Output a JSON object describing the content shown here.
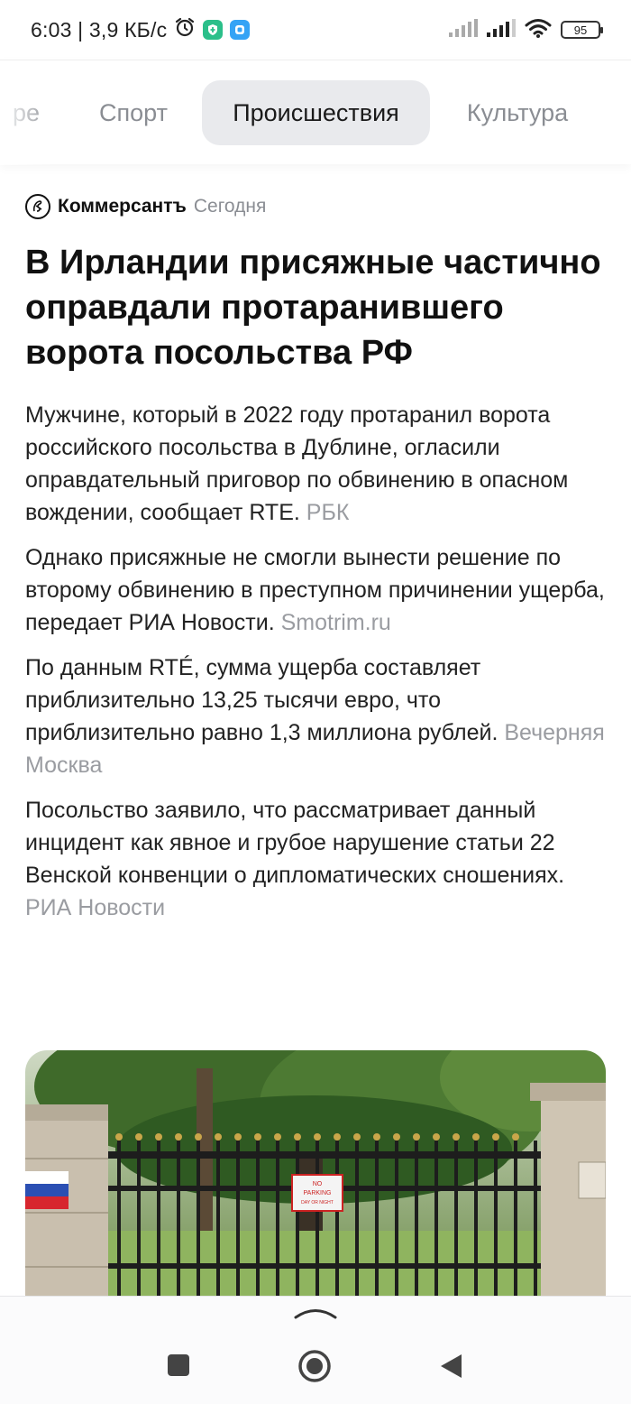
{
  "status_bar": {
    "time_speed": "6:03 | 3,9 КБ/с",
    "battery": "95"
  },
  "tabs": [
    {
      "label": "ре"
    },
    {
      "label": "Спорт"
    },
    {
      "label": "Происшествия"
    },
    {
      "label": "Культура"
    }
  ],
  "article": {
    "source": "Коммерсантъ",
    "time": "Сегодня",
    "headline": "В Ирландии присяжные частично оправдали протаранившего ворота посольства РФ",
    "paragraphs": [
      {
        "text": "Мужчине, который в 2022 году протаранил ворота российского посольства в Дублине, огласили оправдательный приговор по обвинению в опасном вождении, сообщает RTE.",
        "source": "РБК"
      },
      {
        "text": "Однако присяжные не смогли вынести решение по второму обвинению в преступном причинении ущерба, передает РИА Новости.",
        "source": "Smotrim.ru"
      },
      {
        "text": "По данным RTÉ, сумма ущерба составляет приблизительно 13,25 тысячи евро, что приблизительно равно 1,3 миллиона рублей.",
        "source": "Вечерняя Москва"
      },
      {
        "text": "Посольство заявило, что рассматривает данный инцидент как явное и грубое нарушение статьи 22 Венской конвенции о дипломатических сношениях.",
        "source": "РИА Новости"
      }
    ],
    "photo_sign": [
      "NO",
      "PARKING",
      "DAY OR NIGHT"
    ]
  },
  "icons": {
    "alarm": "alarm-icon",
    "app1": "shield-app-icon",
    "app2": "chat-app-icon",
    "signal1": "signal-icon",
    "signal2": "signal-icon",
    "wifi": "wifi-icon",
    "recents": "recents-square-icon",
    "home": "home-circle-icon",
    "back": "back-triangle-icon",
    "swipe": "swipe-up-chevron-icon"
  },
  "colors": {
    "tab_active_bg": "#e9eaed",
    "muted": "#8a8d93"
  }
}
